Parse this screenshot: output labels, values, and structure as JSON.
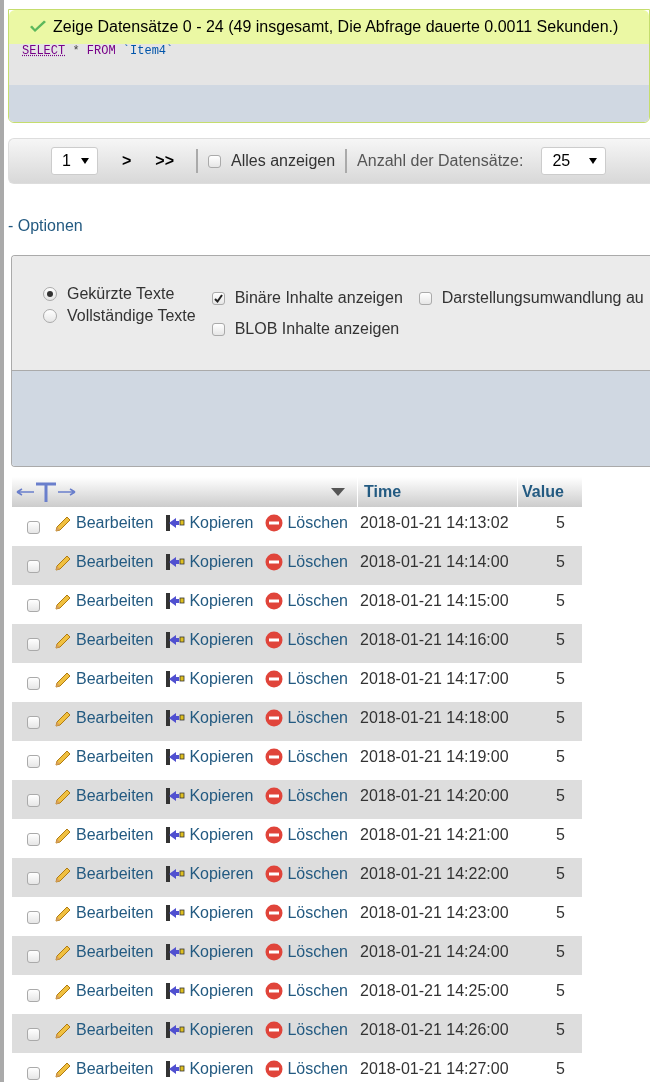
{
  "message": {
    "text": "Zeige Datensätze 0 - 24 (49 insgesamt, Die Abfrage dauerte 0.0011 Sekunden.)"
  },
  "sql": [
    {
      "kind": "keyword",
      "text": "SELECT"
    },
    {
      "kind": "plain",
      "text": "*"
    },
    {
      "kind": "keyword",
      "text": "FROM"
    },
    {
      "kind": "identifier",
      "text": "`Item4`"
    }
  ],
  "navigation": {
    "page": "1",
    "next": ">",
    "last": ">>",
    "show_all": {
      "label": "Alles anzeigen",
      "checked": false
    },
    "rows_label": "Anzahl der Datensätze:",
    "rows_value": "25"
  },
  "options_toggle": "- Optionen",
  "options": {
    "radios": [
      {
        "label": "Gekürzte Texte",
        "selected": true
      },
      {
        "label": "Vollständige Texte",
        "selected": false
      }
    ],
    "checkboxes": [
      {
        "label": "Binäre Inhalte anzeigen",
        "checked": true
      },
      {
        "label": "BLOB Inhalte anzeigen",
        "checked": false
      },
      {
        "label": "Darstellungsumwandlung au",
        "checked": false
      }
    ]
  },
  "table": {
    "columns": [
      "Time",
      "Value"
    ],
    "rows": [
      {
        "checked": false,
        "edit": "Bearbeiten",
        "copy": "Kopieren",
        "delete": "Löschen",
        "time": "2018-01-21 14:13:02",
        "value": "5"
      },
      {
        "checked": false,
        "edit": "Bearbeiten",
        "copy": "Kopieren",
        "delete": "Löschen",
        "time": "2018-01-21 14:14:00",
        "value": "5"
      },
      {
        "checked": false,
        "edit": "Bearbeiten",
        "copy": "Kopieren",
        "delete": "Löschen",
        "time": "2018-01-21 14:15:00",
        "value": "5"
      },
      {
        "checked": false,
        "edit": "Bearbeiten",
        "copy": "Kopieren",
        "delete": "Löschen",
        "time": "2018-01-21 14:16:00",
        "value": "5"
      },
      {
        "checked": false,
        "edit": "Bearbeiten",
        "copy": "Kopieren",
        "delete": "Löschen",
        "time": "2018-01-21 14:17:00",
        "value": "5"
      },
      {
        "checked": false,
        "edit": "Bearbeiten",
        "copy": "Kopieren",
        "delete": "Löschen",
        "time": "2018-01-21 14:18:00",
        "value": "5"
      },
      {
        "checked": false,
        "edit": "Bearbeiten",
        "copy": "Kopieren",
        "delete": "Löschen",
        "time": "2018-01-21 14:19:00",
        "value": "5"
      },
      {
        "checked": false,
        "edit": "Bearbeiten",
        "copy": "Kopieren",
        "delete": "Löschen",
        "time": "2018-01-21 14:20:00",
        "value": "5"
      },
      {
        "checked": false,
        "edit": "Bearbeiten",
        "copy": "Kopieren",
        "delete": "Löschen",
        "time": "2018-01-21 14:21:00",
        "value": "5"
      },
      {
        "checked": false,
        "edit": "Bearbeiten",
        "copy": "Kopieren",
        "delete": "Löschen",
        "time": "2018-01-21 14:22:00",
        "value": "5"
      },
      {
        "checked": false,
        "edit": "Bearbeiten",
        "copy": "Kopieren",
        "delete": "Löschen",
        "time": "2018-01-21 14:23:00",
        "value": "5"
      },
      {
        "checked": false,
        "edit": "Bearbeiten",
        "copy": "Kopieren",
        "delete": "Löschen",
        "time": "2018-01-21 14:24:00",
        "value": "5"
      },
      {
        "checked": false,
        "edit": "Bearbeiten",
        "copy": "Kopieren",
        "delete": "Löschen",
        "time": "2018-01-21 14:25:00",
        "value": "5"
      },
      {
        "checked": false,
        "edit": "Bearbeiten",
        "copy": "Kopieren",
        "delete": "Löschen",
        "time": "2018-01-21 14:26:00",
        "value": "5"
      },
      {
        "checked": false,
        "edit": "Bearbeiten",
        "copy": "Kopieren",
        "delete": "Löschen",
        "time": "2018-01-21 14:27:00",
        "value": "5"
      }
    ]
  }
}
